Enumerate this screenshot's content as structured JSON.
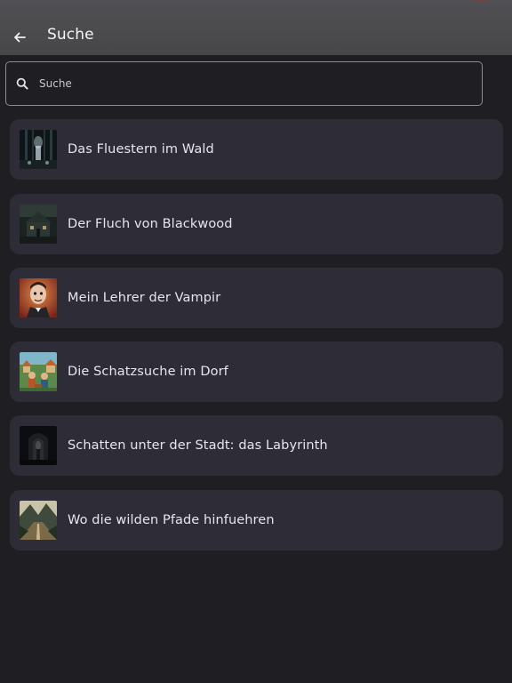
{
  "header": {
    "title": "Suche",
    "back_icon": "back-arrow-icon"
  },
  "search": {
    "placeholder": "Suche",
    "value": "",
    "icon": "search-icon"
  },
  "stories": [
    {
      "title": "Das Fluestern im Wald",
      "thumbnail": "forest-night-thumbnail"
    },
    {
      "title": "Der Fluch von Blackwood",
      "thumbnail": "haunted-house-thumbnail"
    },
    {
      "title": "Mein Lehrer der Vampir",
      "thumbnail": "vampir-teacher-thumbnail"
    },
    {
      "title": "Die Schatzsuche im Dorf",
      "thumbnail": "village-treasure-thumbnail"
    },
    {
      "title": "Schatten unter der Stadt: das Labyrinth",
      "thumbnail": "dark-labyrinth-thumbnail"
    },
    {
      "title": "Wo die wilden Pfade hinfuehren",
      "thumbnail": "mountain-path-thumbnail"
    }
  ],
  "colors": {
    "background": "#1f1e23",
    "app_bar": "#4a494d",
    "card": "#2e2c37",
    "text": "#e7e5ec",
    "outline": "#8e8c94"
  }
}
